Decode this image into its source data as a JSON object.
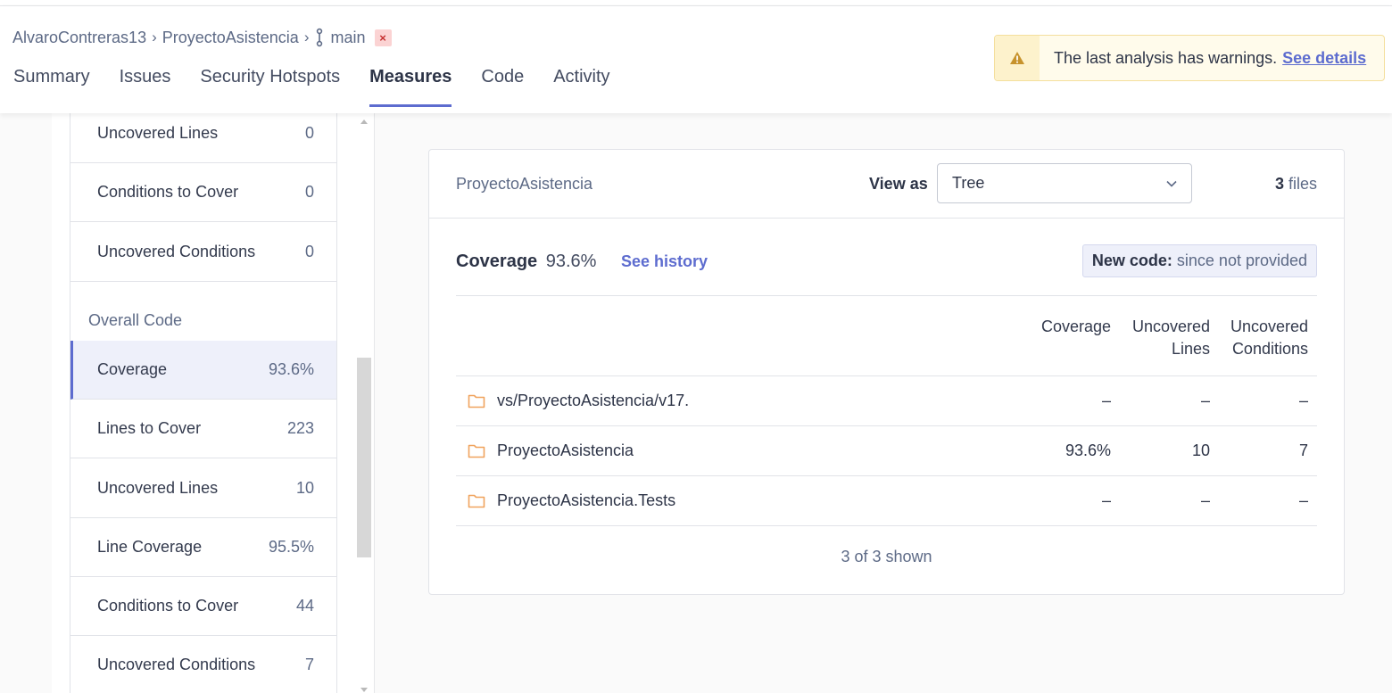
{
  "breadcrumb": {
    "org": "AlvaroContreras13",
    "project": "ProyectoAsistencia",
    "branch": "main",
    "close_symbol": "×"
  },
  "tabs": [
    {
      "label": "Summary"
    },
    {
      "label": "Issues"
    },
    {
      "label": "Security Hotspots"
    },
    {
      "label": "Measures",
      "active": true
    },
    {
      "label": "Code"
    },
    {
      "label": "Activity"
    }
  ],
  "warning": {
    "icon": "warning-triangle-icon",
    "text": "The last analysis has warnings.",
    "link": "See details"
  },
  "sidebar": {
    "new_code_rows": [
      {
        "label": "Uncovered Lines",
        "value": "0"
      },
      {
        "label": "Conditions to Cover",
        "value": "0"
      },
      {
        "label": "Uncovered Conditions",
        "value": "0"
      }
    ],
    "overall_label": "Overall Code",
    "overall_rows": [
      {
        "label": "Coverage",
        "value": "93.6%",
        "active": true
      },
      {
        "label": "Lines to Cover",
        "value": "223"
      },
      {
        "label": "Uncovered Lines",
        "value": "10"
      },
      {
        "label": "Line Coverage",
        "value": "95.5%"
      },
      {
        "label": "Conditions to Cover",
        "value": "44"
      },
      {
        "label": "Uncovered Conditions",
        "value": "7"
      }
    ]
  },
  "card": {
    "project_name": "ProyectoAsistencia",
    "view_as_label": "View as",
    "view_as_value": "Tree",
    "files_count": "3",
    "files_label": "files",
    "measure_name": "Coverage",
    "measure_value": "93.6%",
    "history_link": "See history",
    "new_code_label": "New code:",
    "new_code_value": "since not provided",
    "columns": {
      "coverage": "Coverage",
      "uncovered_lines_1": "Uncovered",
      "uncovered_lines_2": "Lines",
      "uncovered_conditions_1": "Uncovered",
      "uncovered_conditions_2": "Conditions"
    },
    "rows": [
      {
        "name": "vs/ProyectoAsistencia/v17.",
        "coverage": "–",
        "uncovered_lines": "–",
        "uncovered_conditions": "–"
      },
      {
        "name": "ProyectoAsistencia",
        "coverage": "93.6%",
        "uncovered_lines": "10",
        "uncovered_conditions": "7"
      },
      {
        "name": "ProyectoAsistencia.Tests",
        "coverage": "–",
        "uncovered_lines": "–",
        "uncovered_conditions": "–"
      }
    ],
    "shown_text": "3 of 3 shown"
  },
  "colors": {
    "accent": "#5d6ccf",
    "folder": "#f0a35e",
    "warning": "#c7932c"
  }
}
